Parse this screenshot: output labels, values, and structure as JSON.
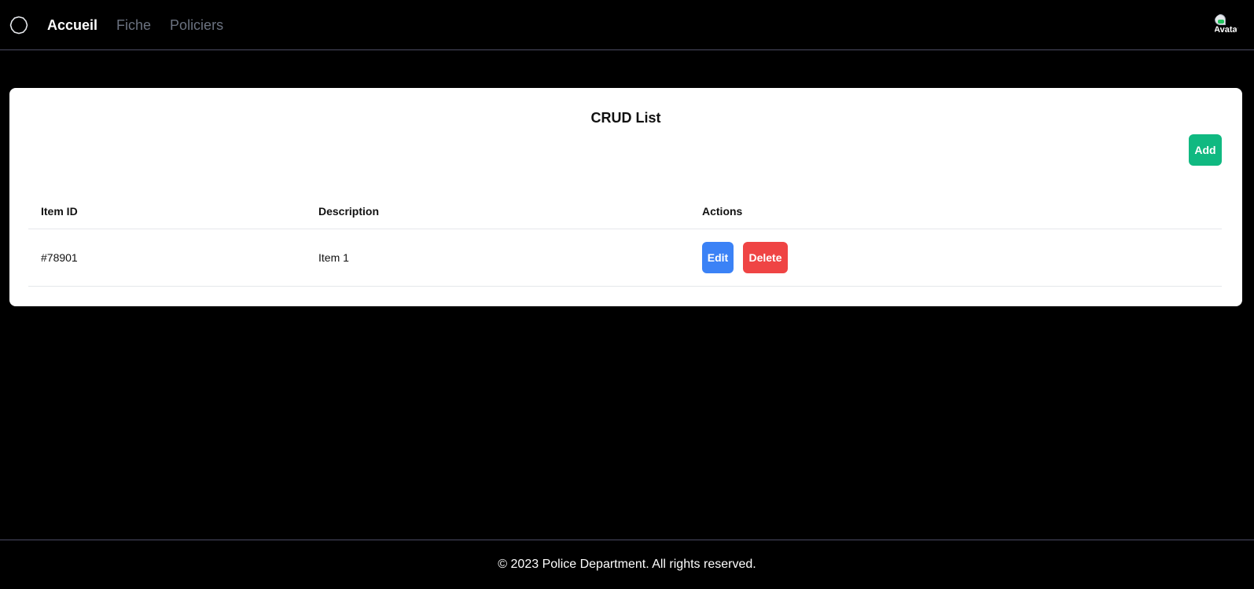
{
  "navbar": {
    "logo_icon": "circle-logo-icon",
    "links": [
      {
        "label": "Accueil",
        "active": true
      },
      {
        "label": "Fiche",
        "active": false
      },
      {
        "label": "Policiers",
        "active": false
      }
    ],
    "avatar_alt": "Avatar"
  },
  "card": {
    "title": "CRUD List",
    "add_label": "Add",
    "table": {
      "headers": [
        "Item ID",
        "Description",
        "Actions"
      ],
      "rows": [
        {
          "id": "#78901",
          "description": "Item 1",
          "edit_label": "Edit",
          "delete_label": "Delete"
        }
      ]
    }
  },
  "footer": {
    "text": "© 2023 Police Department. All rights reserved."
  },
  "colors": {
    "background": "#000000",
    "add": "#10b981",
    "edit": "#3b82f6",
    "delete": "#ef4444"
  }
}
